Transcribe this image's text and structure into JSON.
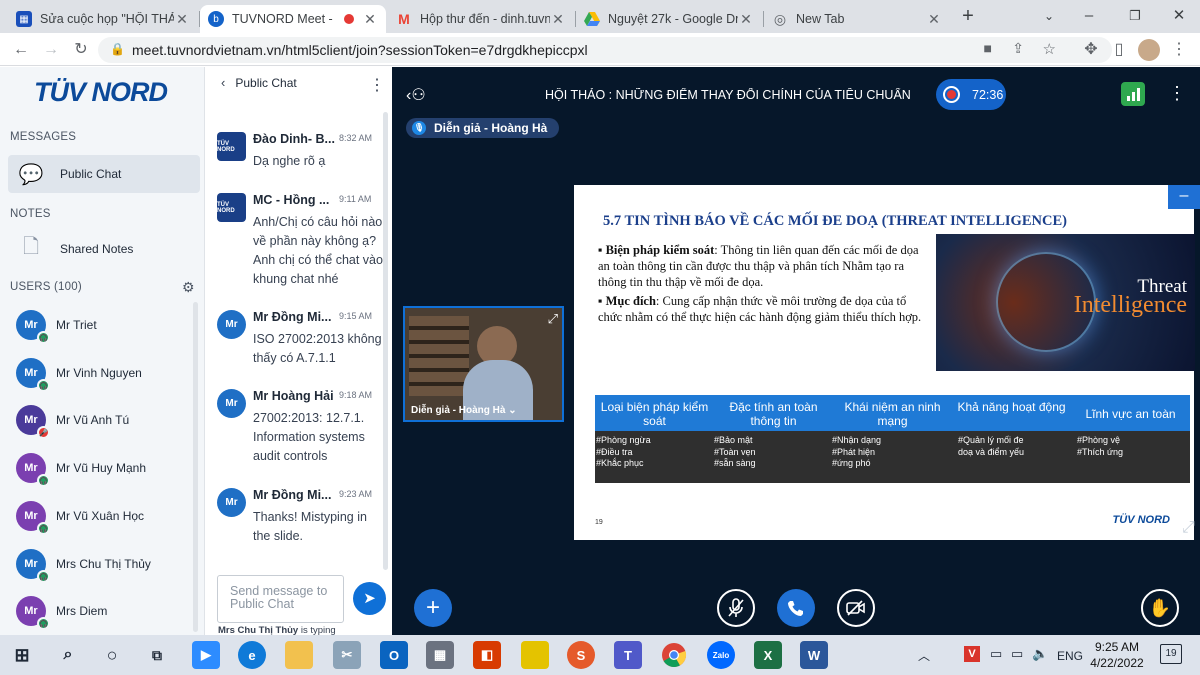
{
  "tabs": [
    {
      "title": "Sửa cuộc họp \"HỘI THẢO",
      "favicon_color": "#1a4fba"
    },
    {
      "title": "TUVNORD Meet - HỘ",
      "favicon_color": "#1463c9"
    },
    {
      "title": "Hộp thư đến - dinh.tuvno",
      "favicon_color": "#ea4335"
    },
    {
      "title": "Nguyệt 27k - Google Driv",
      "favicon_color": "#34a853"
    },
    {
      "title": "New Tab",
      "favicon_color": "#5f6368"
    }
  ],
  "address": {
    "url": "meet.tuvnordvietnam.vn/html5client/join?sessionToken=e7drgdkhepiccpxl"
  },
  "sidebar": {
    "logo": "TÜV NORD",
    "messages_heading": "MESSAGES",
    "public_chat": "Public Chat",
    "notes_heading": "NOTES",
    "shared_notes": "Shared Notes",
    "users_heading": "USERS (100)",
    "users": [
      {
        "name": "Mr Triet",
        "initials": "Mr",
        "color": "#1f6fc5",
        "status": "#1f9d60"
      },
      {
        "name": "Mr Vinh Nguyen",
        "initials": "Mr",
        "color": "#1f6fc5",
        "status": "#1f9d60"
      },
      {
        "name": "Mr Vũ Anh Tú",
        "initials": "Mr",
        "color": "#4a3a9a",
        "status": "#e53935"
      },
      {
        "name": "Mr Vũ Huy Mạnh",
        "initials": "Mr",
        "color": "#7b3fb0",
        "status": "#1f9d60"
      },
      {
        "name": "Mr Vũ Xuân Học",
        "initials": "Mr",
        "color": "#7b3fb0",
        "status": "#1f9d60"
      },
      {
        "name": "Mrs Chu Thị Thủy",
        "initials": "Mr",
        "color": "#1f6fc5",
        "status": "#1f9d60"
      },
      {
        "name": "Mrs Diem",
        "initials": "Mr",
        "color": "#7b3fb0",
        "status": "#1f9d60"
      }
    ]
  },
  "chat": {
    "header": "Public Chat",
    "messages": [
      {
        "name": "Đào Dinh- B...",
        "time": "8:32 AM",
        "avatar": "TÜV NORD",
        "text": "Dạ nghe rõ ạ"
      },
      {
        "name": "MC - Hồng ...",
        "time": "9:11 AM",
        "avatar": "TÜV NORD",
        "text": "Anh/Chị có câu hỏi nào về phần này không ạ? Anh chị có thể chat vào khung chat nhé"
      },
      {
        "name": "Mr Đồng Mi...",
        "time": "9:15 AM",
        "avatar": "Mr",
        "text": "ISO 27002:2013 không thấy có A.7.1.1"
      },
      {
        "name": "Mr Hoàng Hải",
        "time": "9:18 AM",
        "avatar": "Mr",
        "text": "27002:2013: 12.7.1. Information systems audit controls"
      },
      {
        "name": "Mr Đồng Mi...",
        "time": "9:23 AM",
        "avatar": "Mr",
        "text": "Thanks! Mistyping in the slide."
      }
    ],
    "input_placeholder": "Send message to Public Chat",
    "typing_name": "Mrs Chu Thị Thủy",
    "typing_suffix": "is typing"
  },
  "presentation": {
    "title": "HỘI THẢO : NHỮNG ĐIỂM THAY ĐỔI CHÍNH CỦA TIÊU CHUẨN ISO/I...",
    "timer": "72:36",
    "speaker_label": "Diễn giả - Hoàng Hà",
    "video_label": "Diễn giả - Hoàng Hà",
    "slide": {
      "title": "5.7 TIN TÌNH BÁO VỀ CÁC MỐI ĐE DOẠ (THREAT INTELLIGENCE)",
      "bullet1_bold": "Biện pháp kiểm soát",
      "bullet1_text": ": Thông tin liên quan đến các mối đe dọa an toàn thông tin cần được thu thập và phân tích Nhằm tạo ra thông tin thu thập về mối đe dọa.",
      "bullet2_bold": "Mục đích",
      "bullet2_text": ": Cung cấp nhận thức về môi trường đe dọa của tổ chức nhằm có thể thực hiện các hành động giảm thiểu thích hợp.",
      "image_word1": "Threat",
      "image_word2": "Intelligence",
      "table_headers": [
        "Loại biện pháp kiểm soát",
        "Đặc tính an toàn thông tin",
        "Khái niệm an ninh mạng",
        "Khả năng hoạt động",
        "Lĩnh vực an toàn"
      ],
      "table_cells": [
        "#Phòng ngừa\n#Điều tra\n#Khắc phục",
        "#Bảo mật\n#Toàn vẹn\n#sẵn sàng",
        "#Nhận dạng\n#Phát hiện\n#ứng phó",
        "#Quản lý mối đe\ndoạ và điểm yếu",
        "#Phòng vệ\n#Thích ứng"
      ],
      "logo": "TÜV NORD",
      "page_number": "19"
    }
  },
  "taskbar": {
    "language": "ENG",
    "time": "9:25 AM",
    "date": "4/22/2022",
    "notification_count": "19"
  }
}
